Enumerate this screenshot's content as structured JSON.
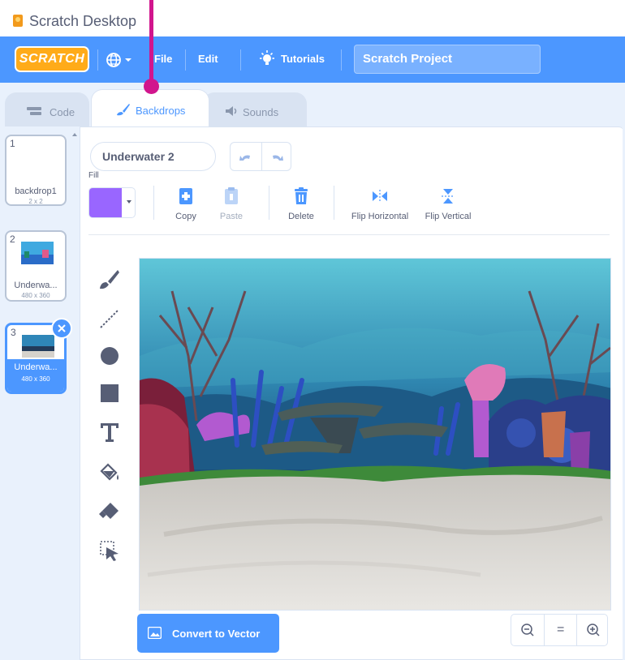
{
  "window": {
    "title": "Scratch Desktop"
  },
  "menubar": {
    "logo": "SCRATCH",
    "file": "File",
    "edit": "Edit",
    "tutorials": "Tutorials",
    "project_title": "Scratch Project"
  },
  "tabs": [
    {
      "label": "Code",
      "active": false
    },
    {
      "label": "Backdrops",
      "active": true
    },
    {
      "label": "Sounds",
      "active": false
    }
  ],
  "backdrops": [
    {
      "number": "1",
      "name": "backdrop1",
      "size": "2 x 2"
    },
    {
      "number": "2",
      "name": "Underwa...",
      "size": "480 x 360"
    },
    {
      "number": "3",
      "name": "Underwa...",
      "size": "480 x 360",
      "selected": true
    }
  ],
  "editor": {
    "costume_name": "Underwater 2",
    "fill_label": "Fill",
    "fill_color": "#9966ff",
    "toolbar": {
      "copy": "Copy",
      "paste": "Paste",
      "delete": "Delete",
      "flip_horizontal": "Flip Horizontal",
      "flip_vertical": "Flip Vertical"
    },
    "convert_button": "Convert to Vector",
    "zoom": {
      "reset": "="
    }
  },
  "colors": {
    "accent": "#4c97ff",
    "annotation": "#d1158d",
    "logo": "#ffab19"
  }
}
